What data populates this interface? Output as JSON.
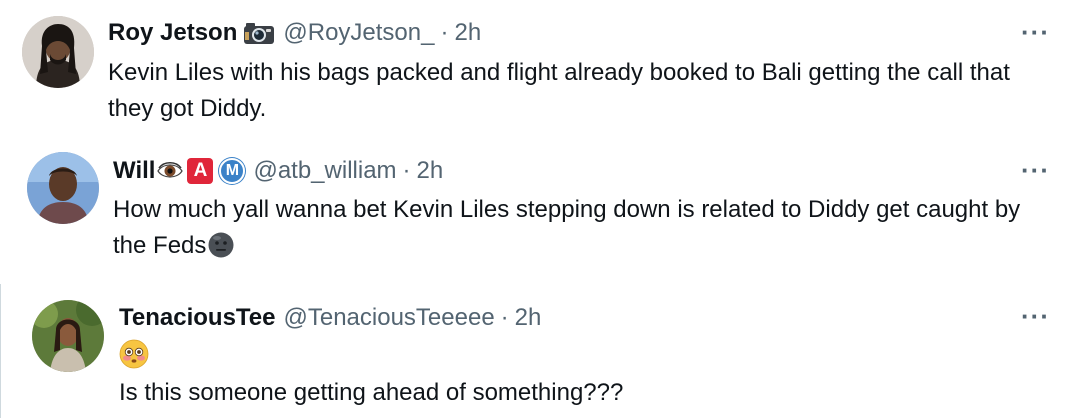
{
  "tweets": [
    {
      "name": "Roy Jetson",
      "handle": "@RoyJetson_",
      "separator": "·",
      "time": "2h",
      "more": "···",
      "text": "Kevin Liles with his bags packed and flight already booked to Bali getting the call that they got Diddy.",
      "badges": [
        "camera-emoji"
      ]
    },
    {
      "name": "Will",
      "handle": "@atb_william",
      "separator": "·",
      "time": "2h",
      "more": "···",
      "text": "How much yall wanna bet Kevin Liles stepping down is related to Diddy get caught by the Feds",
      "badges": [
        "eye-emoji",
        "a-badge",
        "m-badge"
      ],
      "badge_a": "A",
      "badge_m": "M",
      "trailing_emoji": "neutral-dark-face-emoji"
    },
    {
      "name": "TenaciousTee",
      "handle": "@TenaciousTeeeee",
      "separator": "·",
      "time": "2h",
      "more": "···",
      "emoji_line": "flushed-face-emoji",
      "text": "Is this someone getting ahead of something???"
    }
  ],
  "colors": {
    "text": "#0f1419",
    "secondary": "#536471",
    "border": "#cfd9de",
    "a_badge": "#e0263a",
    "m_badge": "#3b82c8"
  }
}
